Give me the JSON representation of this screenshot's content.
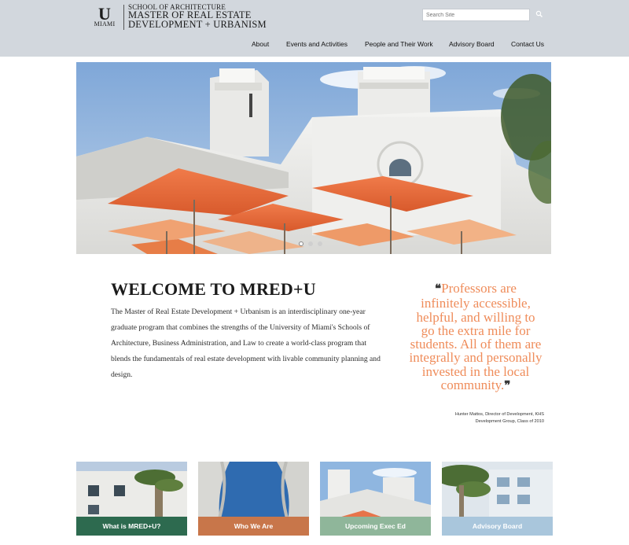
{
  "header": {
    "logo_letter": "U",
    "logo_word": "MIAMI",
    "school": "SCHOOL OF ARCHITECTURE",
    "program_line1": "MASTER OF REAL ESTATE",
    "program_line2": "DEVELOPMENT + URBANISM",
    "search_placeholder": "Search Site",
    "search_icon": "search-icon",
    "background_color": "#d2d7dd"
  },
  "nav": {
    "items": [
      {
        "label": "About"
      },
      {
        "label": "Events and Activities"
      },
      {
        "label": "People and Their Work"
      },
      {
        "label": "Advisory Board"
      },
      {
        "label": "Contact Us"
      }
    ]
  },
  "hero": {
    "slide_count": 3,
    "active_slide": 1
  },
  "welcome": {
    "title": "WELCOME TO MRED+U",
    "body": "The Master of Real Estate Development + Urbanism is an interdisciplinary one-year graduate program that combines the strengths of the University of Miami's Schools of Architecture, Business Administration, and Law to create a world-class program that blends the fundamentals of real estate development with livable community planning and design."
  },
  "quote": {
    "open_mark": "❝",
    "text": "Professors are infinitely accessible, helpful, and willing to go the extra mile for students. All of them are integrally and personally invested in the local community.",
    "close_mark": "❞",
    "attribution_line1": "Hunter Mattos, Director of Development, KHS",
    "attribution_line2": "Development Group, Class of 2010",
    "color": "#ef8c5a"
  },
  "tiles": [
    {
      "label": "What is MRED+U?",
      "color": "#2d6a4f"
    },
    {
      "label": "Who We Are",
      "color": "#c8764a"
    },
    {
      "label": "Upcoming Exec Ed",
      "color": "#8fb69a"
    },
    {
      "label": "Advisory Board",
      "color": "#a9c6dc"
    }
  ]
}
